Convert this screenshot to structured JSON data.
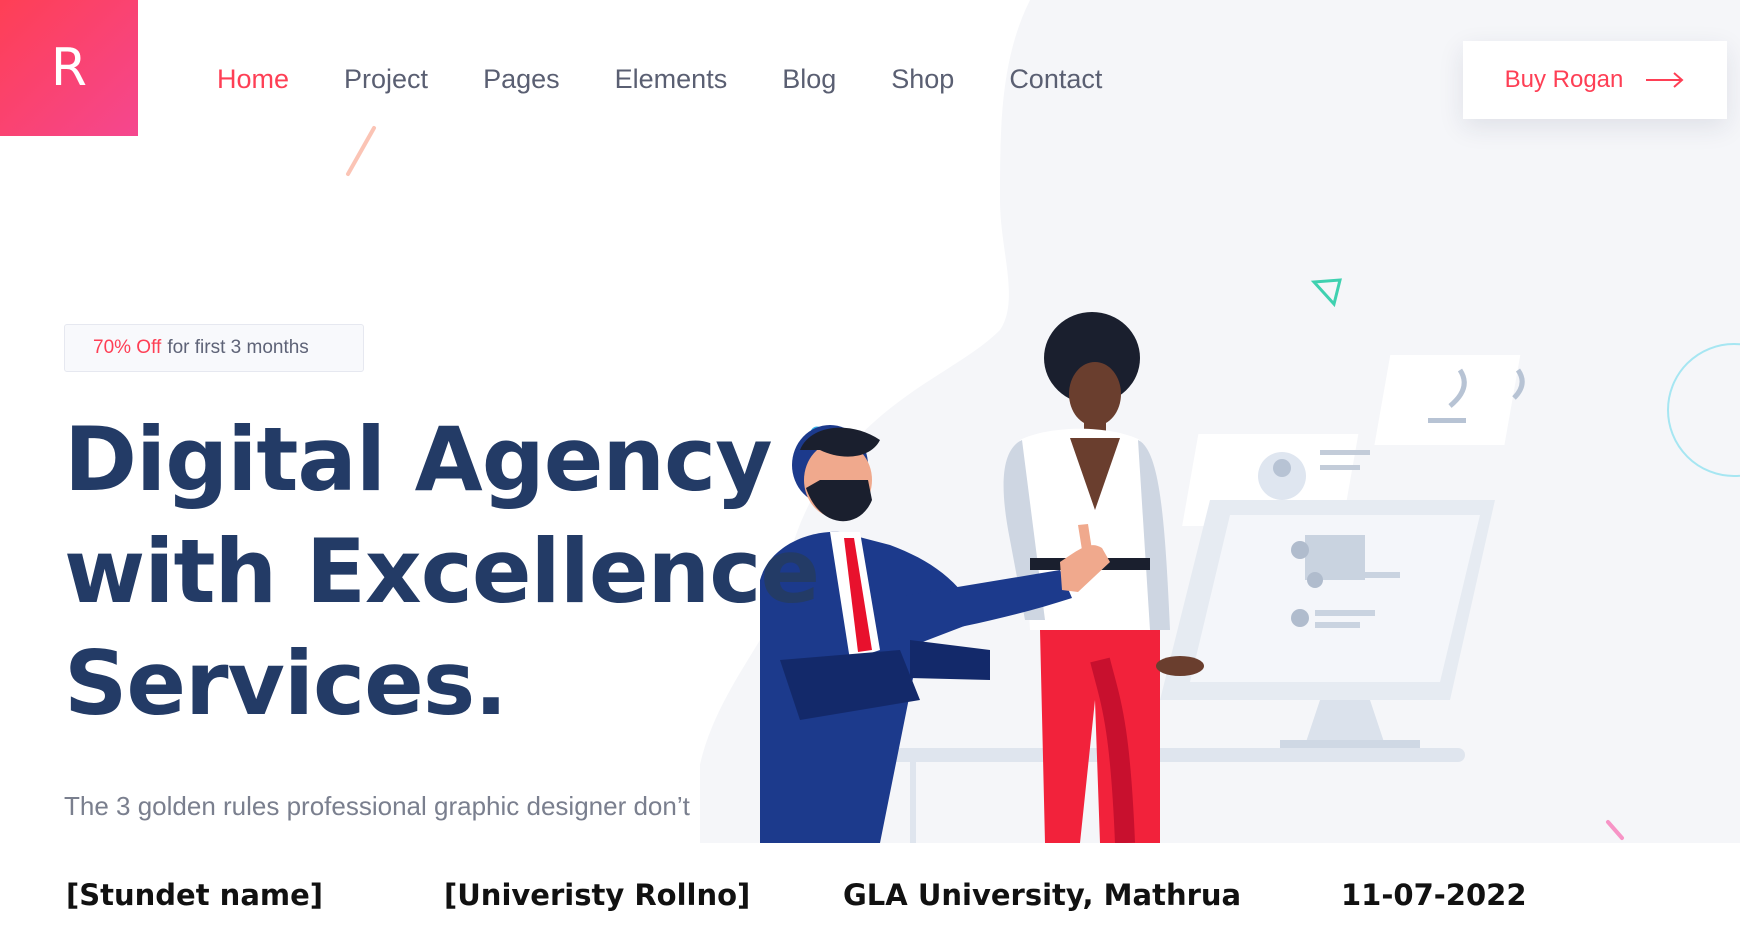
{
  "logo": {
    "letter": "R"
  },
  "nav": {
    "items": [
      {
        "label": "Home",
        "active": true
      },
      {
        "label": "Project",
        "active": false
      },
      {
        "label": "Pages",
        "active": false
      },
      {
        "label": "Elements",
        "active": false
      },
      {
        "label": "Blog",
        "active": false
      },
      {
        "label": "Shop",
        "active": false
      },
      {
        "label": "Contact",
        "active": false
      }
    ]
  },
  "cta": {
    "label": "Buy Rogan",
    "icon": "arrow-right-icon"
  },
  "hero": {
    "badge_highlight": "70% Off",
    "badge_text": "for first 3 months",
    "headline_lines": [
      "Digital Agency",
      "with Excellence",
      "Services."
    ],
    "subtext": "The 3 golden rules professional graphic designer don’t"
  },
  "footer": {
    "student_name": "[Stundet name]",
    "roll_no": "[Univeristy Rollno]",
    "university": "GLA University, Mathrua",
    "date": "11-07-2022"
  },
  "colors": {
    "accent": "#fe3f55",
    "heading": "#233b66",
    "nav_text": "#5a5f72",
    "suit": "#1c3a8c"
  }
}
